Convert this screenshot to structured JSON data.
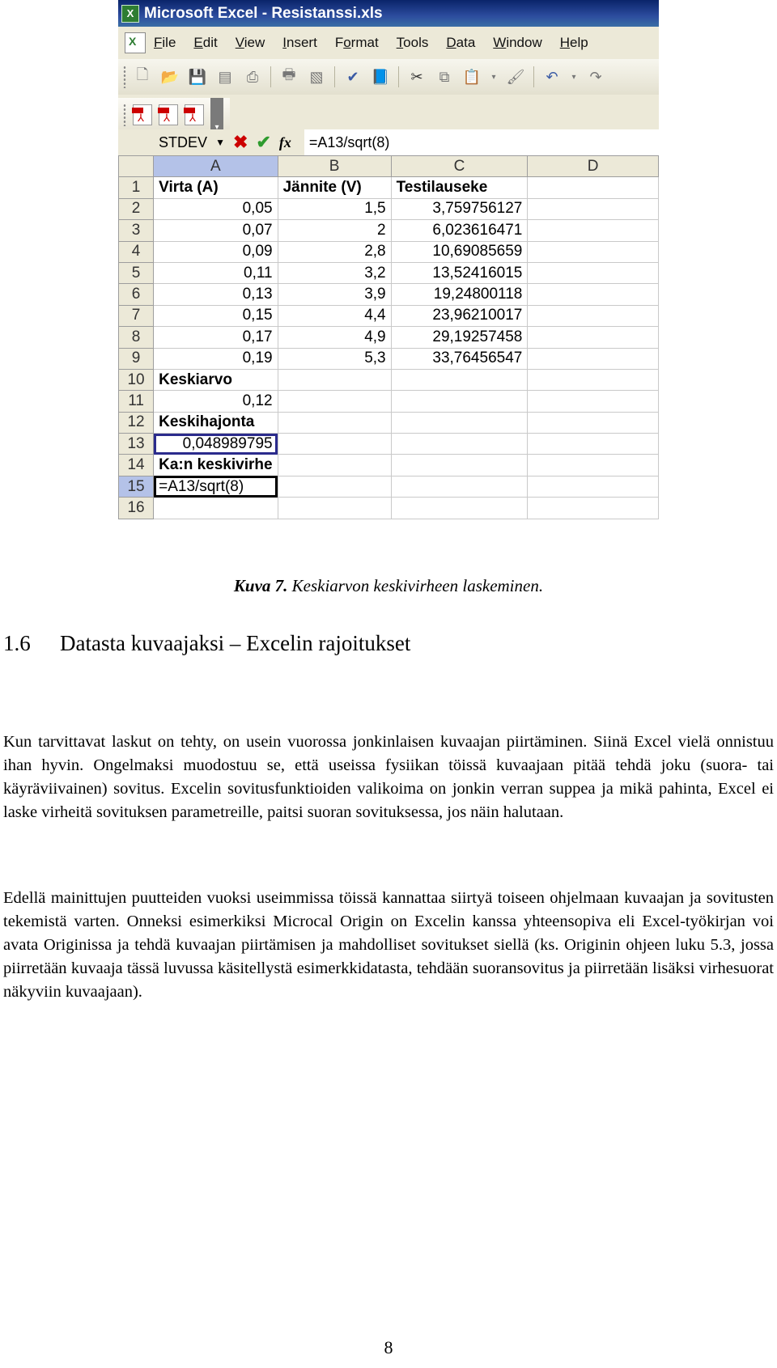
{
  "excel": {
    "window_title": "Microsoft Excel - Resistanssi.xls",
    "menu": [
      "File",
      "Edit",
      "View",
      "Insert",
      "Format",
      "Tools",
      "Data",
      "Window",
      "Help"
    ],
    "menu_accel": [
      "F",
      "E",
      "V",
      "I",
      "o",
      "T",
      "D",
      "W",
      "H"
    ],
    "toolbar_icons": [
      "new-icon",
      "open-icon",
      "save-icon",
      "permission-icon",
      "print-icon",
      "print-preview-icon",
      "spelling-icon",
      "research-icon",
      "cut-icon",
      "copy-icon",
      "paste-icon",
      "format-painter-icon",
      "undo-icon",
      "redo-icon"
    ],
    "pdf_toolbar_icons": [
      "pdf-convert-icon",
      "pdf-convert-email-icon",
      "pdf-convert-review-icon"
    ],
    "name_box": "STDEV",
    "formula": "=A13/sqrt(8)",
    "columns": [
      "A",
      "B",
      "C",
      "D"
    ],
    "rows": [
      {
        "n": "1",
        "a": "Virta (A)",
        "b": "Jännite (V)",
        "c": "Testilauseke"
      },
      {
        "n": "2",
        "a": "0,05",
        "b": "1,5",
        "c": "3,759756127"
      },
      {
        "n": "3",
        "a": "0,07",
        "b": "2",
        "c": "6,023616471"
      },
      {
        "n": "4",
        "a": "0,09",
        "b": "2,8",
        "c": "10,69085659"
      },
      {
        "n": "5",
        "a": "0,11",
        "b": "3,2",
        "c": "13,52416015"
      },
      {
        "n": "6",
        "a": "0,13",
        "b": "3,9",
        "c": "19,24800118"
      },
      {
        "n": "7",
        "a": "0,15",
        "b": "4,4",
        "c": "23,96210017"
      },
      {
        "n": "8",
        "a": "0,17",
        "b": "4,9",
        "c": "29,19257458"
      },
      {
        "n": "9",
        "a": "0,19",
        "b": "5,3",
        "c": "33,76456547"
      },
      {
        "n": "10",
        "a": "Keskiarvo",
        "b": "",
        "c": ""
      },
      {
        "n": "11",
        "a": "0,12",
        "b": "",
        "c": ""
      },
      {
        "n": "12",
        "a": "Keskihajonta",
        "b": "",
        "c": ""
      },
      {
        "n": "13",
        "a": "0,048989795",
        "b": "",
        "c": ""
      },
      {
        "n": "14",
        "a": "Ka:n keskivirhe",
        "b": "",
        "c": ""
      },
      {
        "n": "15",
        "a": "=A13/sqrt(8)",
        "b": "",
        "c": ""
      },
      {
        "n": "16",
        "a": "",
        "b": "",
        "c": ""
      }
    ]
  },
  "caption": {
    "label": "Kuva 7.",
    "text": " Keskiarvon keskivirheen laskeminen."
  },
  "section": {
    "number": "1.6",
    "title": "Datasta kuvaajaksi – Excelin rajoitukset"
  },
  "paragraphs": [
    "Kun tarvittavat laskut on tehty, on usein vuorossa jonkinlaisen kuvaajan piirtäminen. Siinä Excel vielä onnistuu ihan hyvin. Ongelmaksi muodostuu se, että useissa fysiikan töissä kuvaajaan pitää tehdä joku (suora- tai käyräviivainen) sovitus. Excelin sovitusfunktioiden valikoima on jonkin verran suppea ja mikä pahinta, Excel ei laske virheitä sovituksen parametreille, paitsi suoran sovituksessa, jos näin halutaan.",
    "Edellä mainittujen puutteiden vuoksi useimmissa töissä kannattaa siirtyä toiseen ohjelmaan kuvaajan ja sovitusten tekemistä varten. Onneksi esimerkiksi Microcal Origin on Excelin kanssa yhteensopiva eli Excel-työkirjan voi avata Originissa ja tehdä kuvaajan piirtämisen ja mahdolliset sovitukset siellä (ks. Originin ohjeen luku 5.3, jossa piirretään kuvaaja tässä luvussa käsitellystä esimerkkidatasta, tehdään suoransovitus ja piirretään lisäksi virhesuorat näkyviin kuvaajaan)."
  ],
  "page_number": "8"
}
